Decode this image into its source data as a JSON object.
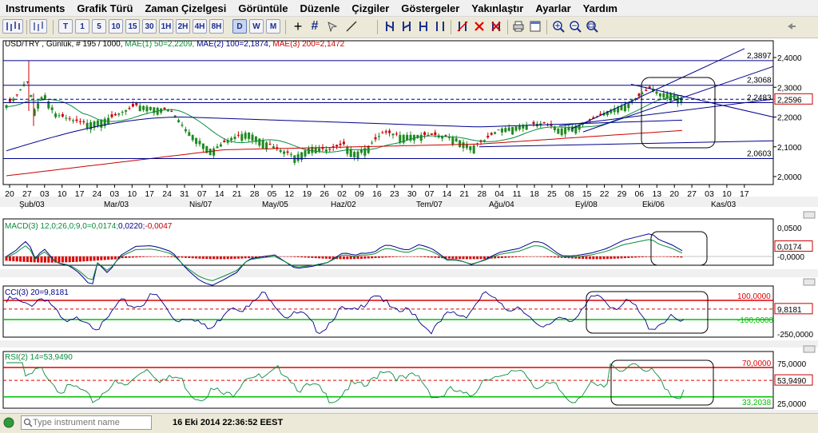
{
  "menu": [
    "Instruments",
    "Grafik Türü",
    "Zaman Çizelgesi",
    "Görüntüle",
    "Düzenle",
    "Çizgiler",
    "Göstergeler",
    "Yakınlaştır",
    "Ayarlar",
    "Yardım"
  ],
  "toolbar": {
    "timeframes": [
      "T",
      "1",
      "5",
      "10",
      "15",
      "30",
      "1H",
      "2H",
      "4H",
      "8H",
      "D",
      "W",
      "M"
    ],
    "selected_timeframe": "D"
  },
  "main_panel": {
    "header": {
      "symbol_info": "USD/TRY , Günlük, # 195 / 1000,",
      "mae1": "MAE(1) 50=2,2209,",
      "mae2": "MAE(2) 100=2,1874,",
      "mae3": "MAE(3) 200=2,1472"
    },
    "price_ticks": [
      "2,4000",
      "2,3000",
      "2,2000",
      "2,1000",
      "2,0000"
    ],
    "hline_labels": [
      "2,3897",
      "2,3068",
      "2,2483",
      "2,0603"
    ],
    "current_price": "2,2596",
    "date_ticks": [
      "20",
      "27",
      "03",
      "10",
      "17",
      "24",
      "03",
      "10",
      "17",
      "24",
      "31",
      "07",
      "14",
      "21",
      "28",
      "05",
      "12",
      "19",
      "26",
      "02",
      "09",
      "16",
      "23",
      "30",
      "07",
      "14",
      "21",
      "28",
      "04",
      "11",
      "18",
      "25",
      "08",
      "15",
      "22",
      "29",
      "06",
      "13",
      "20",
      "27",
      "03",
      "10",
      "17"
    ],
    "month_labels": [
      "Şub/03",
      "Mar/03",
      "Nis/07",
      "May/05",
      "Haz/02",
      "Tem/07",
      "Ağu/04",
      "Eyl/08",
      "Eki/06",
      "Kas/03"
    ]
  },
  "macd_panel": {
    "label": "MACD(3) 12,0;26,0;9,0=0,0174;",
    "value2": "0,0220;",
    "value3": "-0,0047",
    "ticks": [
      "0,0500",
      "-0,0000"
    ],
    "current": "0,0174"
  },
  "cci_panel": {
    "label": "CCI(3) 20=9,8181",
    "level_high": "100,0000",
    "level_low": "-100,0000",
    "ticks": [
      "-250,0000"
    ],
    "current": "9,8181"
  },
  "rsi_panel": {
    "label": "RSI(2) 14=53,9490",
    "level_high": "70,0000",
    "level_low": "33,2038",
    "ticks": [
      "75,0000",
      "25,0000"
    ],
    "current": "53,9490"
  },
  "status_bar": {
    "search_placeholder": "Type instrument name",
    "datetime": "16 Eki 2014 22:36:52 EEST"
  },
  "colors": {
    "chart_blue": "#00008b",
    "candle_green": "#1f8a1f",
    "candle_red": "#cc0000",
    "ma50": "#0a8c3c",
    "ma100": "#00008b",
    "ma200": "#cc0000",
    "level_red": "#e00000",
    "level_green": "#00c000",
    "macd_hist": "#dd0000"
  }
}
